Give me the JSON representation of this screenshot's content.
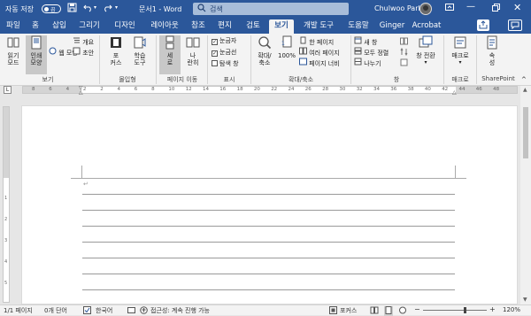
{
  "titlebar": {
    "autosave_label": "자동 저장",
    "autosave_state": "끔",
    "doc_title": "문서1  -  Word",
    "search_placeholder": "검색",
    "user_name": "Chulwoo Park"
  },
  "tabs": [
    "파일",
    "홈",
    "삽입",
    "그리기",
    "디자인",
    "레이아웃",
    "참조",
    "편지",
    "검토",
    "보기",
    "개발 도구",
    "도움말",
    "Ginger",
    "Acrobat"
  ],
  "active_tab": "보기",
  "ribbon": {
    "views": {
      "read_mode": "읽기\n모드",
      "print_layout": "인쇄\n모양",
      "web_layout": "웹 모양",
      "outline": "개요",
      "draft": "초안",
      "label": "보기"
    },
    "immersive": {
      "focus": "포\n커스",
      "learning_tools": "학습\n도구",
      "label": "몰입형"
    },
    "page_movement": {
      "vertical": "세\n로",
      "side_to_side": "나\n란히",
      "label": "페이지 이동"
    },
    "show": {
      "ruler": "눈금자",
      "gridlines": "눈금선",
      "nav_pane": "탐색 창",
      "ruler_checked": true,
      "gridlines_checked": true,
      "nav_pane_checked": false,
      "label": "표시"
    },
    "zoom": {
      "zoom": "확대/\n축소",
      "hundred": "100%",
      "one_page": "한 페이지",
      "multiple_pages": "여러 페이지",
      "page_width": "페이지 너비",
      "label": "확대/축소"
    },
    "window": {
      "new_window": "새 창",
      "arrange_all": "모두 정렬",
      "split": "나누기",
      "switch_windows": "창 전환",
      "label": "창"
    },
    "macros": {
      "macros": "매크로",
      "label": "매크로"
    },
    "sharepoint": {
      "properties": "속\n성",
      "label": "SharePoint"
    }
  },
  "ruler": {
    "ticks": [
      "8",
      "6",
      "4",
      "2",
      "2",
      "4",
      "6",
      "8",
      "10",
      "12",
      "14",
      "16",
      "18",
      "20",
      "22",
      "24",
      "26",
      "28",
      "30",
      "32",
      "34",
      "36",
      "38",
      "40",
      "42",
      "44",
      "46",
      "48"
    ]
  },
  "vruler": {
    "ticks": [
      "1",
      "2",
      "3",
      "4",
      "5"
    ]
  },
  "statusbar": {
    "page": "1/1 페이지",
    "words": "0개 단어",
    "language": "한국어",
    "accessibility": "접근성: 계속 진행 가능",
    "focus": "포커스",
    "zoom": "120%"
  },
  "colors": {
    "accent": "#2b579a",
    "ribbon_bg": "#f3f3f3"
  }
}
